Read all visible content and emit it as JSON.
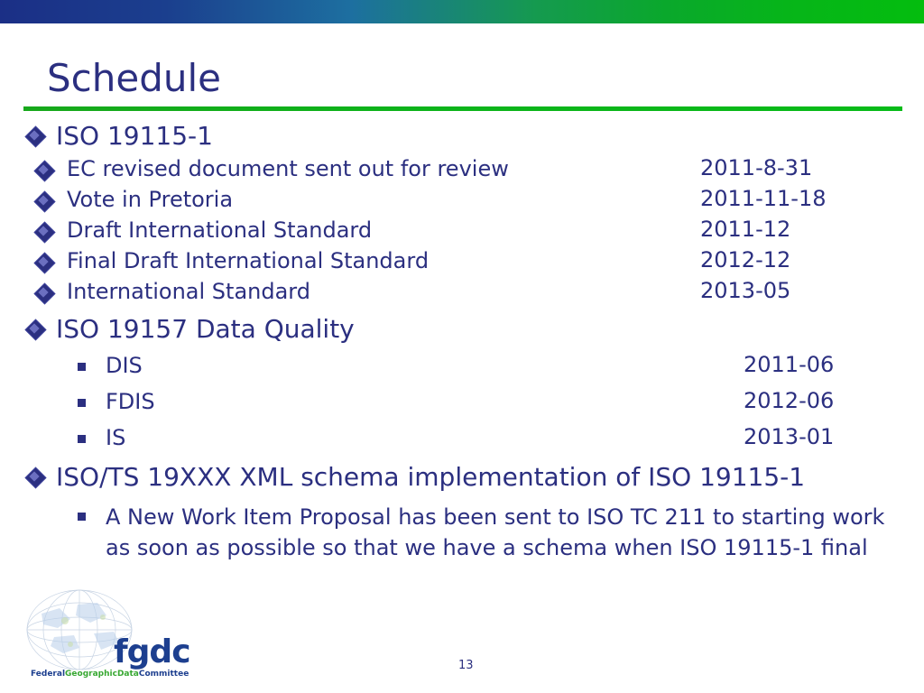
{
  "slide": {
    "title": "Schedule",
    "page_number": "13",
    "sections": [
      {
        "label": "ISO 19115-1",
        "items": [
          {
            "label": "EC revised document sent out for review",
            "date": "2011-8-31"
          },
          {
            "label": "Vote in Pretoria",
            "date": "2011-11-18"
          },
          {
            "label": "Draft International Standard",
            "date": "2011-12"
          },
          {
            "label": "Final Draft International Standard",
            "date": "2012-12"
          },
          {
            "label": "International Standard",
            "date": "2013-05"
          }
        ]
      },
      {
        "label": "ISO 19157 Data Quality",
        "items": [
          {
            "label": "DIS",
            "date": "2011-06"
          },
          {
            "label": "FDIS",
            "date": "2012-06"
          },
          {
            "label": "IS",
            "date": "2013-01"
          }
        ]
      },
      {
        "label": "ISO/TS 19XXX XML schema implementation of ISO 19115-1",
        "paragraph": "A New Work Item Proposal has been sent to ISO TC 211 to starting work as soon as possible so that we have a schema when ISO 19115-1 final"
      }
    ]
  },
  "logo": {
    "wordmark": "fgdc",
    "tagline_federal": "Federal",
    "tagline_geographic": "Geographic",
    "tagline_data": "Data",
    "tagline_committee": "Committee"
  },
  "colors": {
    "text_blue": "#2b2f80",
    "bar_green": "#06b519",
    "bar_blue": "#1b2f86"
  }
}
